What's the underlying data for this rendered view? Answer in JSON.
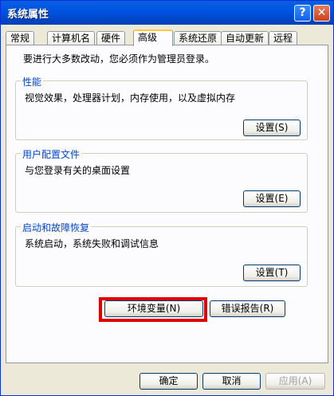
{
  "window": {
    "title": "系统属性",
    "help_glyph": "?",
    "close_glyph": "✕"
  },
  "tabs": [
    {
      "label": "常规"
    },
    {
      "label": "计算机名"
    },
    {
      "label": "硬件"
    },
    {
      "label": "高级"
    },
    {
      "label": "系统还原"
    },
    {
      "label": "自动更新"
    },
    {
      "label": "远程"
    }
  ],
  "intro_text": "要进行大多数改动，您必须作为管理员登录。",
  "performance": {
    "legend": "性能",
    "description": "视觉效果，处理器计划，内存使用，以及虚拟内存",
    "button": "设置(S)"
  },
  "user_profiles": {
    "legend": "用户配置文件",
    "description": "与您登录有关的桌面设置",
    "button": "设置(E)"
  },
  "startup": {
    "legend": "启动和故障恢复",
    "description": "系统启动，系统失败和调试信息",
    "button": "设置(T)"
  },
  "env_button": "环境变量(N)",
  "error_button": "错误报告(R)",
  "footer": {
    "ok": "确定",
    "cancel": "取消",
    "apply": "应用(A)"
  },
  "colors": {
    "title_bar": "#0054e3",
    "highlight_box": "#e00000",
    "active_tab_accent": "#ffc83c"
  }
}
